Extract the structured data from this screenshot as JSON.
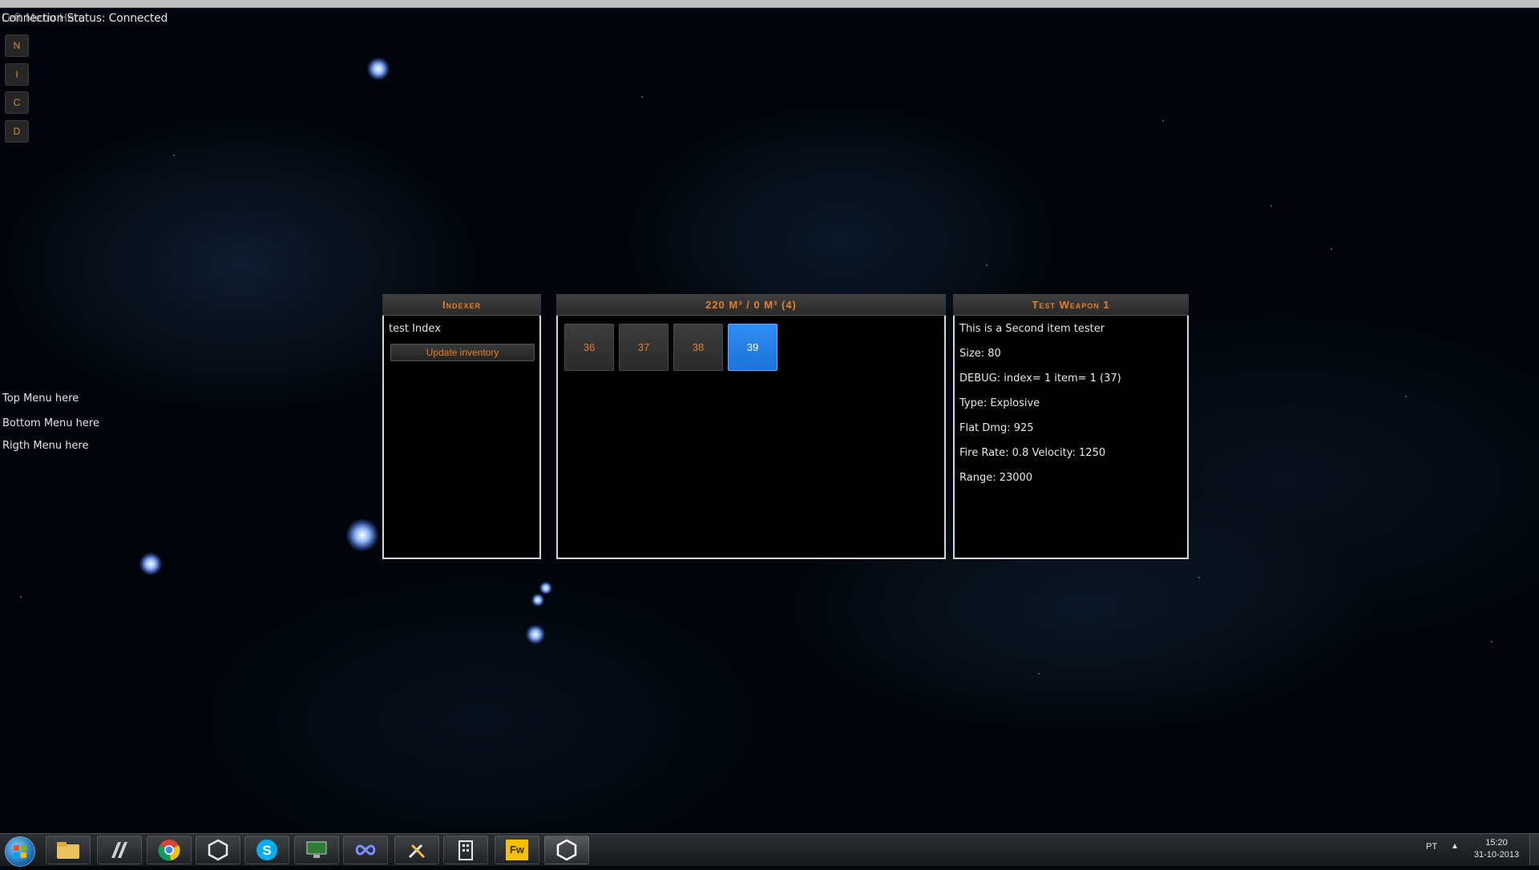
{
  "status": {
    "overlay_text": "Left Menu Here",
    "text": "Connection Status: Connected"
  },
  "left_buttons": [
    "N",
    "I",
    "C",
    "D"
  ],
  "menu_labels": [
    "Top Menu here",
    "Bottom Menu here",
    "Rigth Menu here"
  ],
  "indexer": {
    "title": "Indexer",
    "text": "test Index",
    "button_label": "Update inventory"
  },
  "inventory": {
    "title": "220 M³ / 0 M³ (4)",
    "slots": [
      "36",
      "37",
      "38",
      "39"
    ],
    "selected": "39"
  },
  "weapon": {
    "title": "Test Weapon 1",
    "lines": [
      "This is a Second item tester",
      "Size: 80",
      "DEBUG: index= 1 item= 1 (37)",
      "Type: Explosive",
      "Flat Dmg: 925",
      "Fire Rate: 0.8 Velocity: 1250",
      "Range: 23000"
    ]
  },
  "taskbar": {
    "apps": [
      "folder-icon",
      "app-a-icon",
      "chrome-icon",
      "unity-icon",
      "skype-icon",
      "monitor-icon",
      "infinity-icon",
      "tools-icon",
      "building-icon",
      "fireworks-icon",
      "unity-active-icon"
    ],
    "fw_label": "Fw",
    "skype_label": "S",
    "language": "PT",
    "time": "15:20",
    "date": "31-10-2013"
  },
  "colors": {
    "accent": "#e0802a",
    "selected_slot": "#2f8df4",
    "panel_border": "#d7d7d7"
  }
}
